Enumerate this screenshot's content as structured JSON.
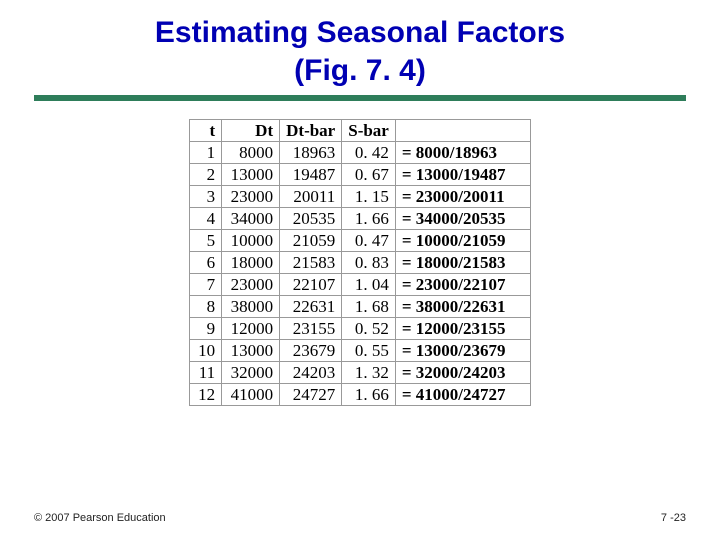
{
  "title_line1": "Estimating Seasonal Factors",
  "title_line2": "(Fig. 7. 4)",
  "headers": {
    "t": "t",
    "dt": "Dt",
    "dtbar": "Dt-bar",
    "sbar": "S-bar"
  },
  "rows": [
    {
      "t": "1",
      "dt": "8000",
      "dtbar": "18963",
      "sbar": "0. 42",
      "eq": "= 8000/18963"
    },
    {
      "t": "2",
      "dt": "13000",
      "dtbar": "19487",
      "sbar": "0. 67",
      "eq": "= 13000/19487"
    },
    {
      "t": "3",
      "dt": "23000",
      "dtbar": "20011",
      "sbar": "1. 15",
      "eq": "= 23000/20011"
    },
    {
      "t": "4",
      "dt": "34000",
      "dtbar": "20535",
      "sbar": "1. 66",
      "eq": "= 34000/20535"
    },
    {
      "t": "5",
      "dt": "10000",
      "dtbar": "21059",
      "sbar": "0. 47",
      "eq": "= 10000/21059"
    },
    {
      "t": "6",
      "dt": "18000",
      "dtbar": "21583",
      "sbar": "0. 83",
      "eq": "= 18000/21583"
    },
    {
      "t": "7",
      "dt": "23000",
      "dtbar": "22107",
      "sbar": "1. 04",
      "eq": "= 23000/22107"
    },
    {
      "t": "8",
      "dt": "38000",
      "dtbar": "22631",
      "sbar": "1. 68",
      "eq": "= 38000/22631"
    },
    {
      "t": "9",
      "dt": "12000",
      "dtbar": "23155",
      "sbar": "0. 52",
      "eq": "= 12000/23155"
    },
    {
      "t": "10",
      "dt": "13000",
      "dtbar": "23679",
      "sbar": "0. 55",
      "eq": "= 13000/23679"
    },
    {
      "t": "11",
      "dt": "32000",
      "dtbar": "24203",
      "sbar": "1. 32",
      "eq": "= 32000/24203"
    },
    {
      "t": "12",
      "dt": "41000",
      "dtbar": "24727",
      "sbar": "1. 66",
      "eq": "= 41000/24727"
    }
  ],
  "footer": "© 2007 Pearson Education",
  "pager": "7 -23"
}
